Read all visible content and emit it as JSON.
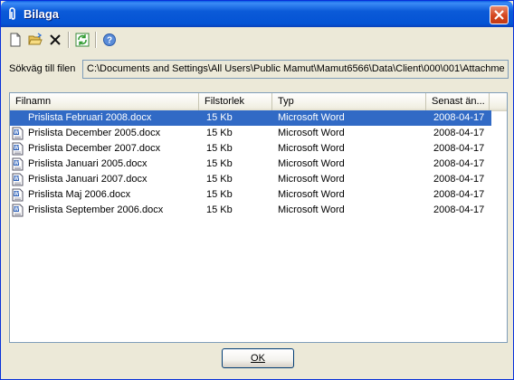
{
  "window": {
    "title": "Bilaga"
  },
  "toolbar": {
    "buttons": [
      {
        "name": "new",
        "icon": "new-document-icon"
      },
      {
        "name": "open",
        "icon": "open-folder-icon"
      },
      {
        "name": "delete",
        "icon": "delete-x-icon"
      },
      {
        "name": "refresh",
        "icon": "refresh-icon"
      },
      {
        "name": "help",
        "icon": "help-icon"
      }
    ]
  },
  "path": {
    "label": "Sökväg till filen",
    "value": "C:\\Documents and Settings\\All Users\\Public Mamut\\Mamut6566\\Data\\Client\\000\\001\\Attachme"
  },
  "list": {
    "columns": [
      "Filnamn",
      "Filstorlek",
      "Typ",
      "Senast än..."
    ],
    "rows": [
      {
        "name": "Prislista Februari 2008.docx",
        "size": "15 Kb",
        "type": "Microsoft Word",
        "date": "2008-04-17",
        "selected": true
      },
      {
        "name": "Prislista December 2005.docx",
        "size": "15 Kb",
        "type": "Microsoft Word",
        "date": "2008-04-17"
      },
      {
        "name": "Prislista December 2007.docx",
        "size": "15 Kb",
        "type": "Microsoft Word",
        "date": "2008-04-17"
      },
      {
        "name": "Prislista Januari 2005.docx",
        "size": "15 Kb",
        "type": "Microsoft Word",
        "date": "2008-04-17"
      },
      {
        "name": "Prislista Januari 2007.docx",
        "size": "15 Kb",
        "type": "Microsoft Word",
        "date": "2008-04-17"
      },
      {
        "name": "Prislista Maj 2006.docx",
        "size": "15 Kb",
        "type": "Microsoft Word",
        "date": "2008-04-17"
      },
      {
        "name": "Prislista September 2006.docx",
        "size": "15 Kb",
        "type": "Microsoft Word",
        "date": "2008-04-17"
      }
    ]
  },
  "ok_button": {
    "label": "OK"
  },
  "colors": {
    "titlebar": "#0453D4",
    "selection": "#316AC5",
    "close": "#D4451E",
    "face": "#ECE9D8"
  }
}
